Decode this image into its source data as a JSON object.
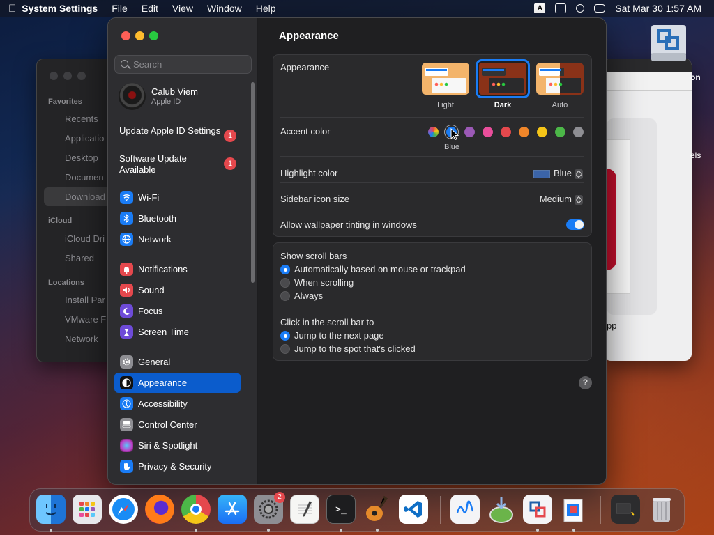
{
  "menubar": {
    "app": "System Settings",
    "menus": [
      "File",
      "Edit",
      "View",
      "Window",
      "Help"
    ],
    "input_indicator": "A",
    "clock": "Sat Mar 30  1:57 AM"
  },
  "finder": {
    "favorites_header": "Favorites",
    "favorites": [
      "Recents",
      "Applicatio",
      "Desktop",
      "Documen",
      "Download"
    ],
    "icloud_header": "iCloud",
    "icloud": [
      "iCloud Dri",
      "Shared"
    ],
    "locations_header": "Locations",
    "locations": [
      "Install Par",
      "VMware F",
      "Network"
    ]
  },
  "back_window": {
    "label_on": "on",
    "label_els": "els",
    "label_pp": "pp"
  },
  "settings": {
    "search_placeholder": "Search",
    "user": {
      "name": "Calub Viem",
      "sub": "Apple ID"
    },
    "notices": [
      {
        "label": "Update Apple ID Settings",
        "badge": "1"
      },
      {
        "label": "Software Update Available",
        "badge": "1"
      }
    ],
    "sidebar": [
      {
        "label": "Wi-Fi",
        "icon": "wifi-icon",
        "color": "#1a7cf5"
      },
      {
        "label": "Bluetooth",
        "icon": "bluetooth-icon",
        "color": "#1a7cf5"
      },
      {
        "label": "Network",
        "icon": "globe-icon",
        "color": "#1a7cf5"
      },
      {
        "label": "Notifications",
        "icon": "bell-icon",
        "color": "#e5484d"
      },
      {
        "label": "Sound",
        "icon": "speaker-icon",
        "color": "#e5484d"
      },
      {
        "label": "Focus",
        "icon": "moon-icon",
        "color": "#6e4bd8"
      },
      {
        "label": "Screen Time",
        "icon": "hourglass-icon",
        "color": "#6e4bd8"
      },
      {
        "label": "General",
        "icon": "gear-icon",
        "color": "#8e8e93"
      },
      {
        "label": "Appearance",
        "icon": "appearance-icon",
        "color": "#111111"
      },
      {
        "label": "Accessibility",
        "icon": "accessibility-icon",
        "color": "#1a7cf5"
      },
      {
        "label": "Control Center",
        "icon": "control-center-icon",
        "color": "#8e8e93"
      },
      {
        "label": "Siri & Spotlight",
        "icon": "siri-icon",
        "color": "#c03cc7"
      },
      {
        "label": "Privacy & Security",
        "icon": "hand-icon",
        "color": "#1a7cf5"
      }
    ],
    "selected": "Appearance",
    "page_title": "Appearance",
    "appearance": {
      "label": "Appearance",
      "options": [
        "Light",
        "Dark",
        "Auto"
      ],
      "selected": "Dark"
    },
    "accent": {
      "label": "Accent color",
      "selected_name": "Blue",
      "colors": [
        "multicolor",
        "#1a7cf5",
        "#9b59b6",
        "#e94e9b",
        "#e5484d",
        "#f0862a",
        "#f5c518",
        "#4cb748",
        "#8e8e93"
      ]
    },
    "highlight": {
      "label": "Highlight color",
      "value": "Blue"
    },
    "sidebar_icon": {
      "label": "Sidebar icon size",
      "value": "Medium"
    },
    "tinting": {
      "label": "Allow wallpaper tinting in windows",
      "on": true
    },
    "scroll_bars": {
      "label": "Show scroll bars",
      "options": [
        "Automatically based on mouse or trackpad",
        "When scrolling",
        "Always"
      ],
      "selected": "Automatically based on mouse or trackpad"
    },
    "click_scroll": {
      "label": "Click in the scroll bar to",
      "options": [
        "Jump to the next page",
        "Jump to the spot that's clicked"
      ],
      "selected": "Jump to the next page"
    },
    "help": "?"
  },
  "dock": {
    "apps": [
      "Finder",
      "Launchpad",
      "Safari",
      "Firefox",
      "Chrome",
      "App Store",
      "System Settings",
      "TextEdit",
      "Terminal",
      "GarageBand",
      "Visual Studio Code",
      "Freeform",
      "Sequoia Installer",
      "VMware Fusion",
      "Preview",
      "Downloads",
      "Trash"
    ],
    "settings_badge": "2"
  }
}
